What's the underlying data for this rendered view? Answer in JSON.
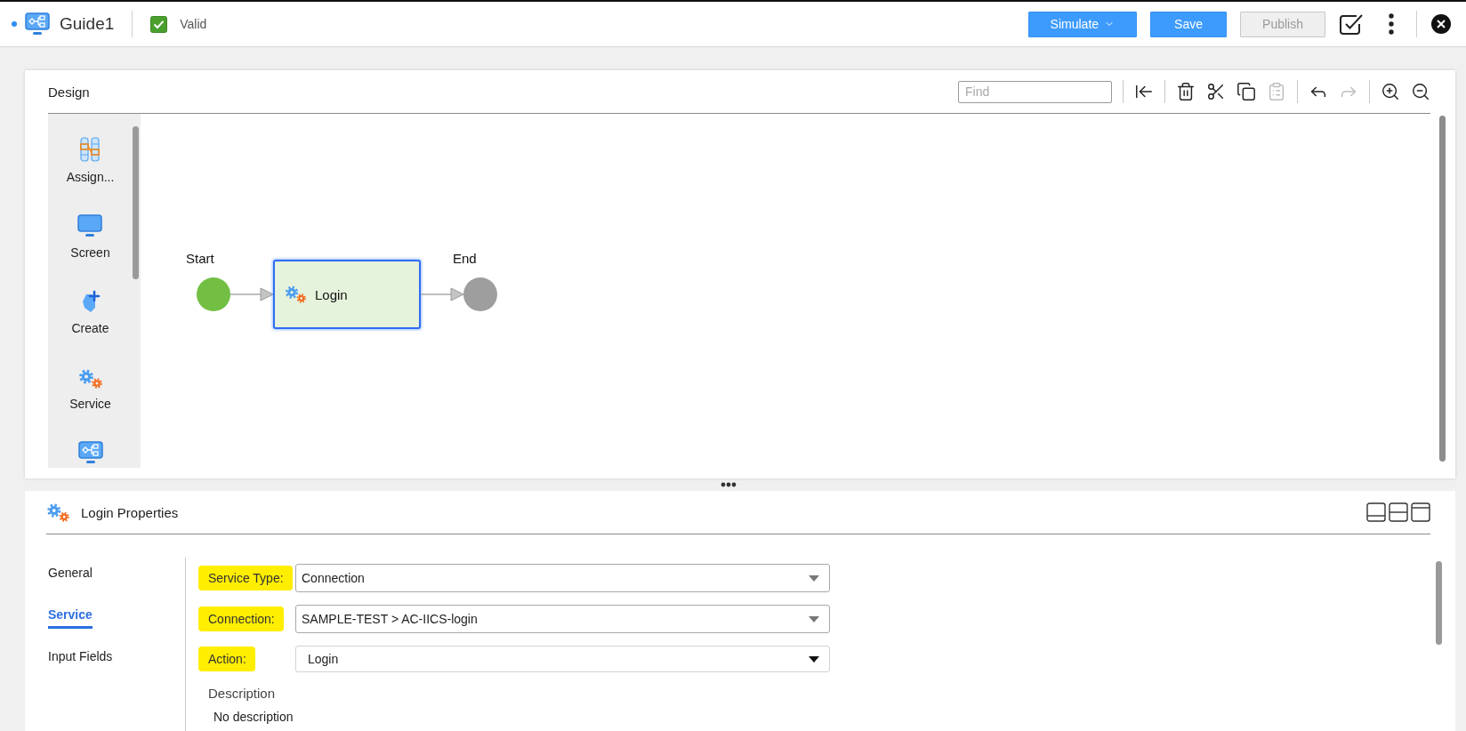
{
  "header": {
    "modified": true,
    "title": "Guide1",
    "validation": {
      "label": "Valid",
      "checked": true
    },
    "buttons": [
      {
        "label": "Simulate",
        "kind": "dropdown",
        "disabled": false
      },
      {
        "label": "Save",
        "kind": "plain",
        "disabled": false
      },
      {
        "label": "Publish",
        "kind": "plain",
        "disabled": true
      }
    ],
    "icon_buttons": [
      {
        "kind": "validate"
      },
      {
        "kind": "more"
      },
      {
        "kind": "close"
      }
    ]
  },
  "design": {
    "title": "Design",
    "find": {
      "placeholder": "Find"
    },
    "tool_groups": [
      [
        {
          "kind": "collapse",
          "disabled": false
        }
      ],
      [
        {
          "kind": "delete",
          "disabled": false
        },
        {
          "kind": "cut",
          "disabled": false
        },
        {
          "kind": "copy",
          "disabled": false
        },
        {
          "kind": "paste",
          "disabled": true
        }
      ],
      [
        {
          "kind": "undo",
          "disabled": false
        },
        {
          "kind": "redo",
          "disabled": true
        }
      ],
      [
        {
          "kind": "zoom_in",
          "disabled": false
        },
        {
          "kind": "zoom_out",
          "disabled": false
        }
      ]
    ],
    "palette": [
      {
        "kind": "assignment",
        "label": "Assign..."
      },
      {
        "kind": "screen",
        "label": "Screen"
      },
      {
        "kind": "create",
        "label": "Create"
      },
      {
        "kind": "service",
        "label": "Service"
      },
      {
        "kind": "subprocess"
      }
    ],
    "nodes": [
      {
        "kind": "start",
        "label": "Start",
        "selected": false
      },
      {
        "kind": "service",
        "label": "Login",
        "selected": true
      },
      {
        "kind": "end",
        "label": "End",
        "selected": false
      }
    ]
  },
  "properties": {
    "title": "Login Properties",
    "layout_buttons": [
      {
        "kind": "bottom"
      },
      {
        "kind": "split"
      },
      {
        "kind": "top"
      }
    ],
    "tabs": [
      {
        "label": "General",
        "selected": false
      },
      {
        "label": "Service",
        "selected": true
      },
      {
        "label": "Input Fields",
        "selected": false
      }
    ],
    "fields": [
      {
        "label": "Service Type:",
        "value": "Connection",
        "kind": "select",
        "highlighted": true
      },
      {
        "label": "Connection:",
        "value": "SAMPLE-TEST > AC-IICS-login",
        "kind": "select",
        "highlighted": true
      },
      {
        "label": "Action:",
        "value": "Login",
        "kind": "picklist",
        "highlighted": true
      }
    ],
    "description": {
      "label": "Description",
      "value": "No description"
    }
  }
}
